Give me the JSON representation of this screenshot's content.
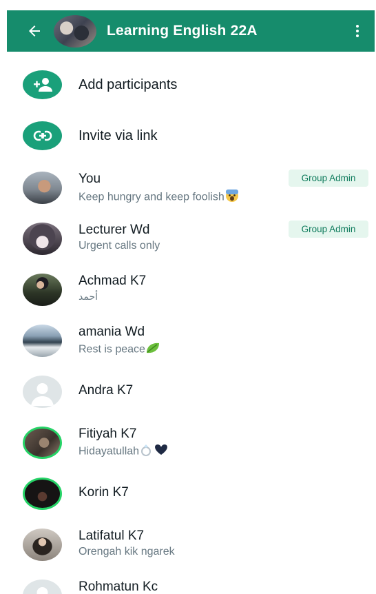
{
  "header": {
    "title": "Learning English 22A",
    "back_icon": "arrow-left-icon",
    "menu_icon": "more-vertical-icon"
  },
  "actions": [
    {
      "label": "Add participants",
      "icon": "add-person-icon"
    },
    {
      "label": "Invite via link",
      "icon": "link-icon"
    }
  ],
  "badge_label": "Group Admin",
  "participants": [
    {
      "name": "You",
      "status": "Keep hungry and keep foolish",
      "status_emoji": "fear-face-emoji",
      "admin": true
    },
    {
      "name": "Lecturer Wd",
      "status": "Urgent calls only",
      "admin": true
    },
    {
      "name": "Achmad K7",
      "status": "أحمد",
      "admin": false
    },
    {
      "name": "amania Wd",
      "status": "Rest is peace",
      "status_emoji": "leaf-emoji",
      "admin": false
    },
    {
      "name": "Andra K7",
      "status": "",
      "admin": false
    },
    {
      "name": "Fitiyah K7",
      "status": "Hidayatullah",
      "status_emoji": "ring-and-heart-emoji",
      "admin": false
    },
    {
      "name": "Korin K7",
      "status": "",
      "admin": false
    },
    {
      "name": "Latifatul K7",
      "status": "Orengah kik ngarek",
      "admin": false
    },
    {
      "name": "Rohmatun Kc",
      "status": "",
      "admin": false
    }
  ],
  "colors": {
    "header": "#168c6c",
    "accent": "#1aa07a",
    "badge_bg": "#e5f6ee",
    "badge_text": "#0e7b5c",
    "secondary_text": "#667781"
  }
}
